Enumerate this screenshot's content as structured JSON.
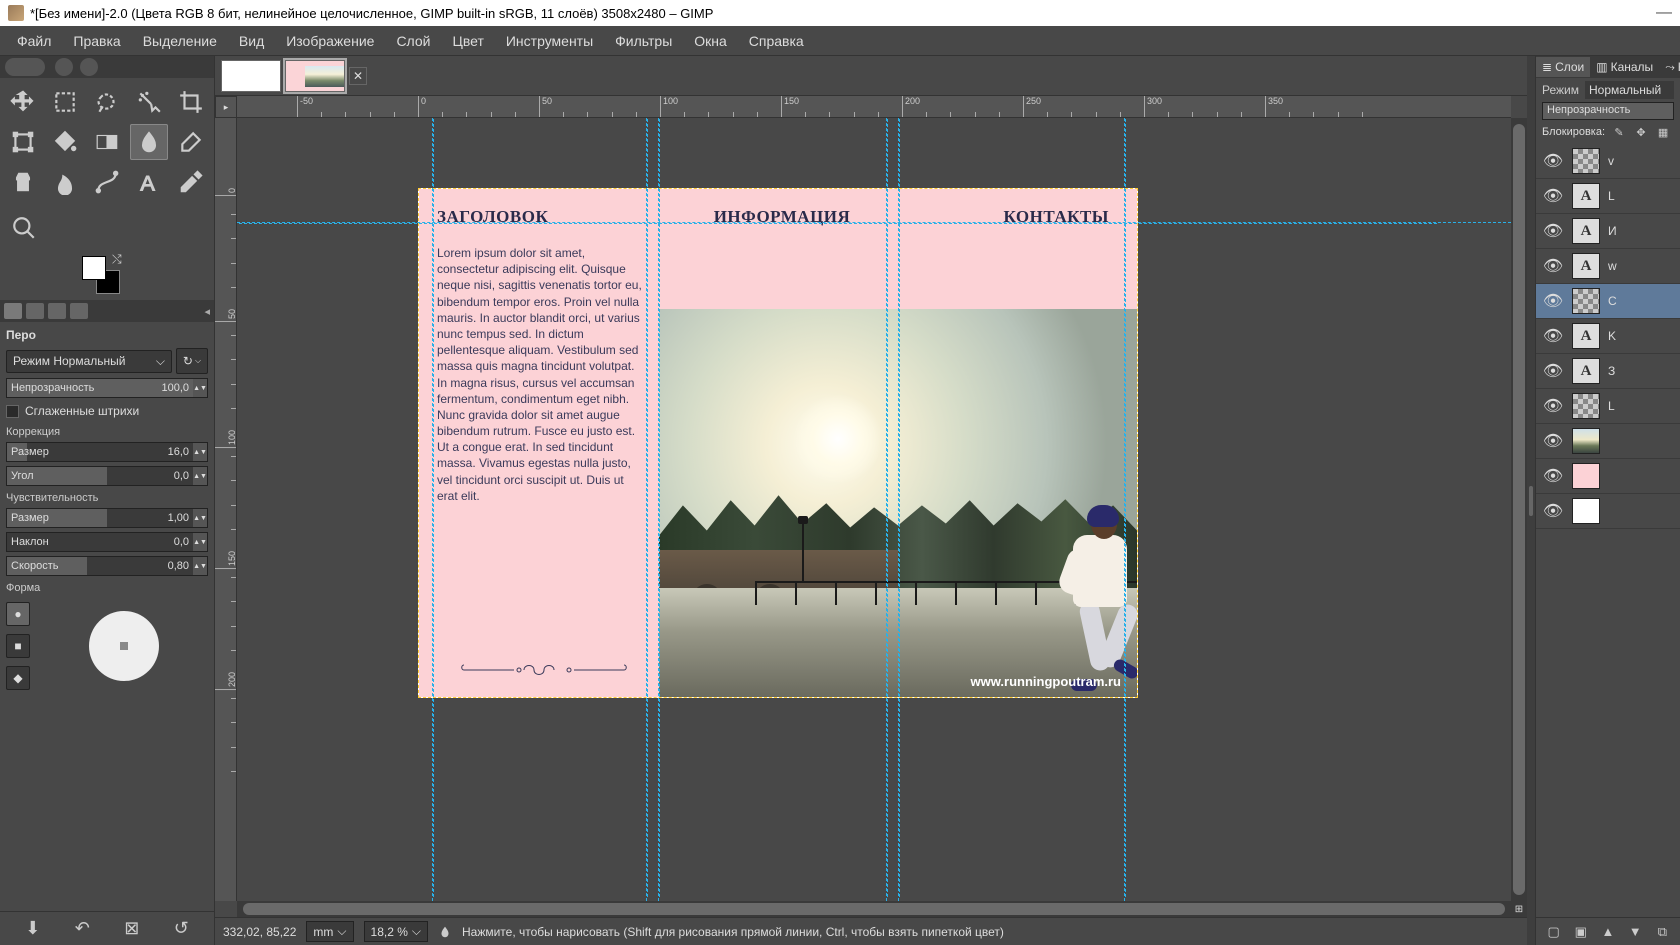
{
  "titlebar": {
    "title": "*[Без имени]-2.0 (Цвета RGB 8 бит, нелинейное целочисленное, GIMP built-in sRGB, 11 слоёв) 3508x2480 – GIMP",
    "minimize": "—"
  },
  "menu": [
    "Файл",
    "Правка",
    "Выделение",
    "Вид",
    "Изображение",
    "Слой",
    "Цвет",
    "Инструменты",
    "Фильтры",
    "Окна",
    "Справка"
  ],
  "options": {
    "title": "Перо",
    "mode_label": "Режим",
    "mode_value": "Нормальный",
    "opacity_label": "Непрозрачность",
    "opacity_value": "100,0",
    "smooth": "Сглаженные штрихи",
    "correction": "Коррекция",
    "size_label": "Размер",
    "size_value": "16,0",
    "angle_label": "Угол",
    "angle_value": "0,0",
    "sensitivity": "Чувствительность",
    "sens_size_label": "Размер",
    "sens_size_value": "1,00",
    "tilt_label": "Наклон",
    "tilt_value": "0,0",
    "speed_label": "Скорость",
    "speed_value": "0,80",
    "shape": "Форма"
  },
  "status": {
    "coords": "332,02, 85,22",
    "unit": "mm",
    "zoom": "18,2 %",
    "hint": "Нажмите, чтобы нарисовать (Shift для рисования прямой линии, Ctrl, чтобы взять пипеткой цвет)"
  },
  "right": {
    "tab_layers": "Слои",
    "tab_channels": "Каналы",
    "tab_paths_letter": "К",
    "mode_label": "Режим",
    "mode_value": "Нормальный",
    "opacity_label": "Непрозрачность",
    "lock_label": "Блокировка:"
  },
  "layers": [
    {
      "name": "v",
      "thumb": "checker"
    },
    {
      "name": "L",
      "thumb": "text"
    },
    {
      "name": "И",
      "thumb": "text"
    },
    {
      "name": "w",
      "thumb": "text"
    },
    {
      "name": "C",
      "thumb": "checker",
      "active": true
    },
    {
      "name": "K",
      "thumb": "text"
    },
    {
      "name": "З",
      "thumb": "text"
    },
    {
      "name": "L",
      "thumb": "checker"
    },
    {
      "name": "",
      "thumb": "photo-t"
    },
    {
      "name": "",
      "thumb": "pink"
    },
    {
      "name": "",
      "thumb": "white"
    }
  ],
  "canvas": {
    "heading1": "ЗАГОЛОВОК",
    "heading2": "ИНФОРМАЦИЯ",
    "heading3": "КОНТАКТЫ",
    "lorem": "Lorem ipsum dolor sit amet, consectetur adipiscing elit. Quisque neque nisi, sagittis venenatis tortor eu, bibendum tempor eros. Proin vel nulla mauris. In auctor blandit orci, ut varius nunc tempus sed. In dictum pellentesque aliquam. Vestibulum sed massa quis magna tincidunt volutpat. In magna risus, cursus vel accumsan fermentum, condimentum eget nibh. Nunc gravida dolor sit amet augue bibendum rutrum. Fusce eu justo est. Ut a congue erat. In sed tincidunt massa. Vivamus egestas nulla justo, vel tincidunt orci suscipit ut. Duis ut erat elit.",
    "url": "www.runningpoutram.ru"
  },
  "ruler_h": [
    {
      "pos": 60,
      "label": "-50"
    },
    {
      "pos": 181,
      "label": "0"
    },
    {
      "pos": 302,
      "label": "50"
    },
    {
      "pos": 423,
      "label": "100"
    },
    {
      "pos": 544,
      "label": "150"
    },
    {
      "pos": 665,
      "label": "200"
    },
    {
      "pos": 786,
      "label": "250"
    },
    {
      "pos": 907,
      "label": "300"
    },
    {
      "pos": 1028,
      "label": "350"
    }
  ],
  "ruler_v": [
    {
      "pos": 70,
      "label": "0"
    },
    {
      "pos": 191,
      "label": "50"
    },
    {
      "pos": 312,
      "label": "100"
    },
    {
      "pos": 433,
      "label": "150"
    },
    {
      "pos": 554,
      "label": "200"
    }
  ]
}
